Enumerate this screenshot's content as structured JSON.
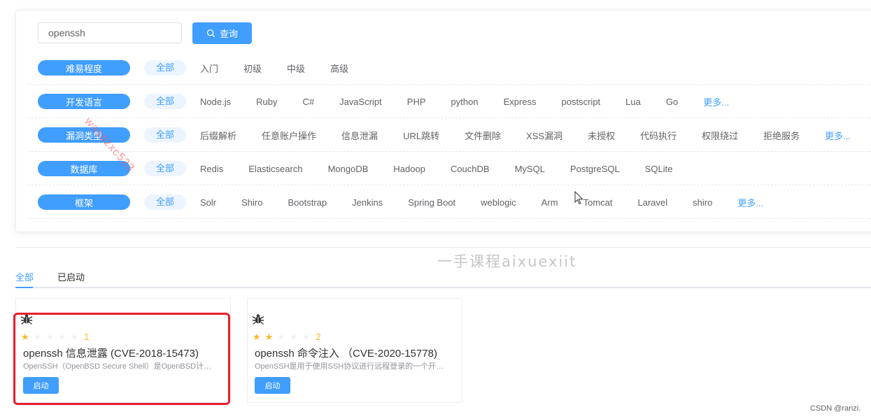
{
  "search": {
    "value": "openssh",
    "button_label": "查询"
  },
  "filters": [
    {
      "label": "难易程度",
      "options": [
        "全部",
        "入门",
        "初级",
        "中级",
        "高级"
      ],
      "more": ""
    },
    {
      "label": "开发语言",
      "options": [
        "全部",
        "Node.js",
        "Ruby",
        "C#",
        "JavaScript",
        "PHP",
        "python",
        "Express",
        "postscript",
        "Lua",
        "Go"
      ],
      "more": "更多..."
    },
    {
      "label": "漏洞类型",
      "options": [
        "全部",
        "后缀解析",
        "任意账户操作",
        "信息泄漏",
        "URL跳转",
        "文件删除",
        "XSS漏洞",
        "未授权",
        "代码执行",
        "权限绕过",
        "拒绝服务"
      ],
      "more": "更多..."
    },
    {
      "label": "数据库",
      "options": [
        "全部",
        "Redis",
        "Elasticsearch",
        "MongoDB",
        "Hadoop",
        "CouchDB",
        "MySQL",
        "PostgreSQL",
        "SQLite"
      ],
      "more": ""
    },
    {
      "label": "框架",
      "options": [
        "全部",
        "Solr",
        "Shiro",
        "Bootstrap",
        "Jenkins",
        "Spring Boot",
        "weblogic",
        "Arm",
        "Tomcat",
        "Laravel",
        "shiro"
      ],
      "more": "更多..."
    }
  ],
  "tabs": {
    "all": "全部",
    "started": "已启动"
  },
  "cards": [
    {
      "stars": 1,
      "rating": "1",
      "title": "openssh 信息泄露 (CVE-2018-15473)",
      "desc": "OpenSSH（OpenBSD Secure Shell）是OpenBSD计划组的一套用于安全访问远程计算机的连接工具",
      "button": "启动"
    },
    {
      "stars": 2,
      "rating": "2",
      "title": "openssh 命令注入 （CVE-2020-15778)",
      "desc": "OpenSSH是用于使用SSH协议进行远程登录的一个开源实现",
      "button": "启动"
    }
  ],
  "watermarks": {
    "diagonal": "wasdzxc523",
    "center": "一手课程aixuexiit",
    "csdn": "CSDN @ranzi."
  },
  "colors": {
    "primary": "#409eff",
    "star": "#f7ba2a",
    "highlight": "#e5202e"
  },
  "icons": {
    "search": "search-icon",
    "bug": "bug-icon",
    "star": "star-icon",
    "cursor": "mouse-cursor-icon"
  }
}
